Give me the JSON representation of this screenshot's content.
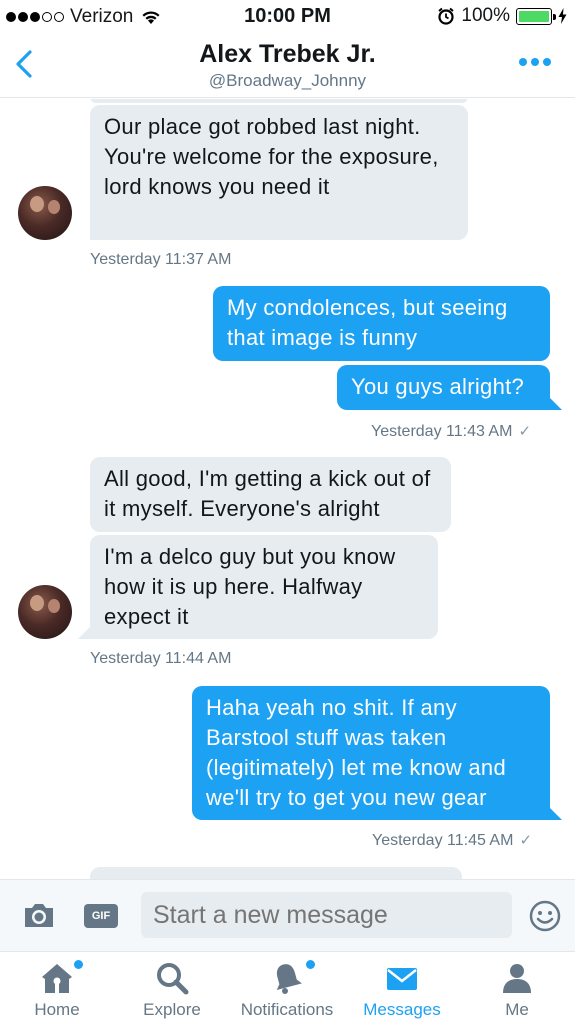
{
  "status_bar": {
    "carrier": "Verizon",
    "time": "10:00 PM",
    "battery": "100%"
  },
  "header": {
    "title": "Alex Trebek Jr.",
    "handle": "@Broadway_Johnny"
  },
  "messages": [
    {
      "direction": "incoming",
      "text": "Our place got robbed last night. You're welcome for the exposure, lord knows you need it"
    },
    {
      "direction": "timestamp-in",
      "text": "Yesterday 11:37 AM"
    },
    {
      "direction": "outgoing",
      "text": "My condolences, but seeing that image is funny"
    },
    {
      "direction": "outgoing",
      "text": "You guys alright?"
    },
    {
      "direction": "timestamp-out",
      "text": "Yesterday 11:43 AM"
    },
    {
      "direction": "incoming",
      "text": "All good, I'm getting a kick out of it myself. Everyone's alright"
    },
    {
      "direction": "incoming",
      "text": "I'm a delco guy but you know how it is up here. Halfway expect it"
    },
    {
      "direction": "timestamp-in",
      "text": "Yesterday 11:44 AM"
    },
    {
      "direction": "outgoing",
      "text": "Haha yeah no shit.  If any Barstool stuff was taken (legitimately) let me know and we'll try to get you new gear"
    },
    {
      "direction": "timestamp-out",
      "text": "Yesterday 11:45 AM"
    }
  ],
  "composer": {
    "gif_label": "GIF",
    "placeholder": "Start a new message"
  },
  "tabs": [
    {
      "label": "Home",
      "icon": "home-icon",
      "active": false
    },
    {
      "label": "Explore",
      "icon": "search-icon",
      "active": false
    },
    {
      "label": "Notifications",
      "icon": "bell-icon",
      "active": false
    },
    {
      "label": "Messages",
      "icon": "envelope-icon",
      "active": true
    },
    {
      "label": "Me",
      "icon": "person-icon",
      "active": false
    }
  ],
  "colors": {
    "accent": "#1da1f2",
    "incoming_bubble": "#e6ecf0",
    "muted_text": "#657786"
  }
}
